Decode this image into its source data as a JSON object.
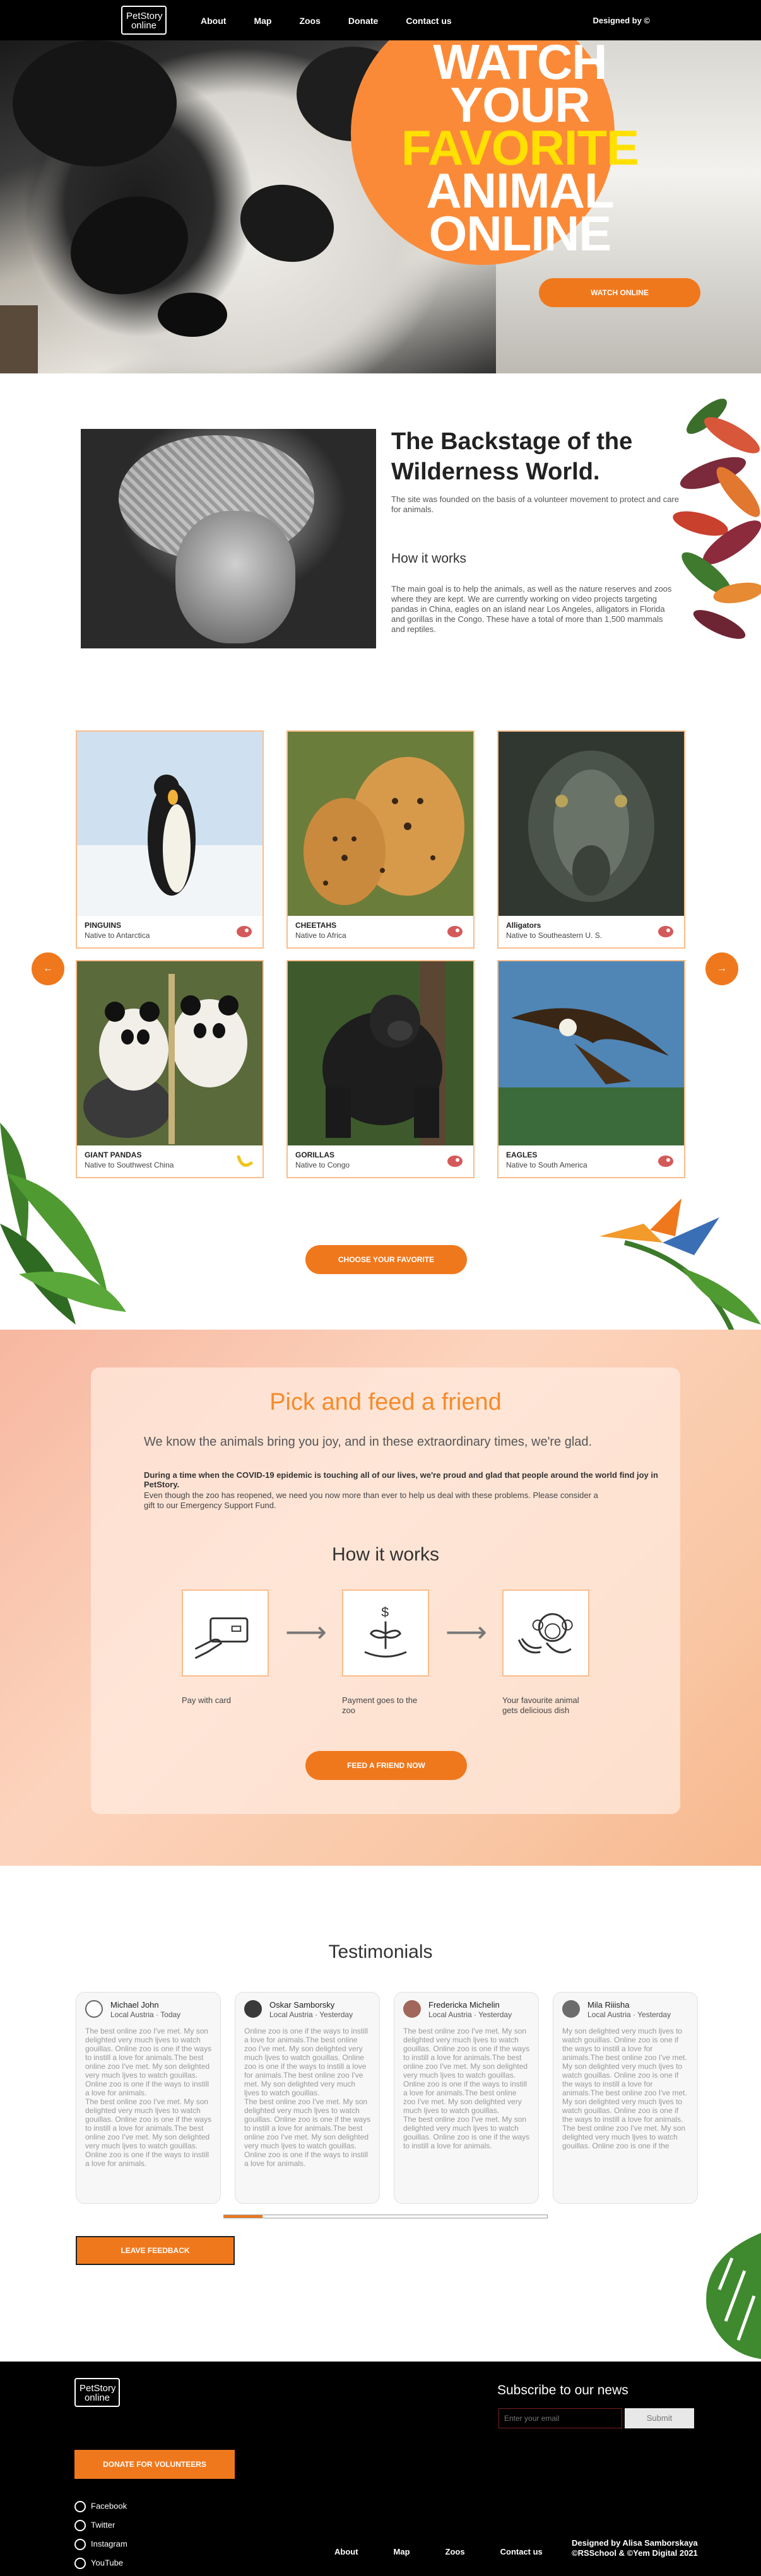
{
  "header": {
    "logo_line1": "PetStory",
    "logo_line2": "online",
    "nav": [
      "About",
      "Map",
      "Zoos",
      "Donate",
      "Contact us"
    ],
    "designed_by": "Designed by ©"
  },
  "hero": {
    "line1": "WATCH",
    "line2": "YOUR",
    "line3": "FAVORITE",
    "line4": "ANIMAL",
    "line5": "ONLINE",
    "button": "WATCH ONLINE"
  },
  "backstage": {
    "title": "The Backstage of the Wilderness World.",
    "text1": "The site was founded on the basis of a volunteer movement to protect and care for animals.",
    "subtitle": "How it works",
    "text2": "The main goal is to help the animals, as well as the nature reserves and zoos where they are kept. We are currently working on video projects targeting pandas in China, eagles on an island near Los Angeles, alligators in Florida and gorillas in the Congo. These have a total of more than 1,500 mammals and reptiles."
  },
  "animals": [
    {
      "name": "PINGUINS",
      "native": "Native to Antarctica",
      "badge": "meat-icon"
    },
    {
      "name": "CHEETAHS",
      "native": "Native to Africa",
      "badge": "meat-icon"
    },
    {
      "name": "Alligators",
      "native": "Native to Southeastern U. S.",
      "badge": "meat-icon"
    },
    {
      "name": "GIANT PANDAS",
      "native": "Native to Southwest China",
      "badge": "banana-icon"
    },
    {
      "name": "GORILLAS",
      "native": "Native to Congo",
      "badge": "meat-icon"
    },
    {
      "name": "EAGLES",
      "native": "Native to South America",
      "badge": "meat-icon"
    }
  ],
  "carousel": {
    "prev": "←",
    "next": "→"
  },
  "favorite_button": "CHOOSE YOUR FAVORITE",
  "feed": {
    "title": "Pick and feed a friend",
    "lead": "We know the animals bring you joy, and in these extraordinary times, we're glad.",
    "p1": "During a time when the COVID-19 epidemic is touching all of our lives, we're proud and glad that people around the world find joy in PetStory.",
    "p2": "Even though the zoo has reopened, we need you now more than ever to help us deal with these problems. Please consider a gift to our Emergency Support Fund.",
    "subtitle": "How it works",
    "steps": [
      {
        "label": "Pay with card",
        "icon": "credit-card-icon"
      },
      {
        "label": "Payment goes to the zoo",
        "icon": "money-plant-icon"
      },
      {
        "label": "Your favourite animal gets delicious dish",
        "icon": "monkey-banana-icon"
      }
    ],
    "button": "FEED A FRIEND NOW"
  },
  "testimonials": {
    "title": "Testimonials",
    "items": [
      {
        "name": "Michael John",
        "meta": "Local Austria · Today",
        "text": "The best online zoo I've met. My son delighted very much ljves to watch gouillas. Online zoo is one if the ways to instill a love for animals.The best online zoo I've met. My son delighted very much ljves to watch gouillas. Online zoo is one if the ways to instill a love for animals.\nThe best online zoo I've met. My son delighted very much ljves to watch gouillas. Online zoo is one if the ways to instill a love for animals.The best online zoo I've met. My son delighted very much ljves to watch gouillas. Online zoo is one if the ways to instill a love for animals."
      },
      {
        "name": "Oskar Samborsky",
        "meta": "Local Austria · Yesterday",
        "text": "Online zoo is one if the ways to instill a love for animals.The best online zoo I've met. My son delighted very much ljves to watch gouillas. Online zoo is one if the ways to instill a love for animals.The best online zoo I've met. My son delighted very much ljves to watch gouillas.\nThe best online zoo I've met. My son delighted very much ljves to watch gouillas. Online zoo is one if the ways to instill a love for animals.The best online zoo I've met. My son delighted very much ljves to watch gouillas. Online zoo is one if the ways to instill a love for animals."
      },
      {
        "name": "Fredericka Michelin",
        "meta": "Local Austria · Yesterday",
        "text": "The best online zoo I've met. My son delighted very much ljves to watch gouillas. Online zoo is one if the ways to instill a love for animals.The best online zoo I've met. My son delighted very much ljves to watch gouillas. Online zoo is one if the ways to instill a love for animals.The best online zoo I've met. My son delighted very much ljves to watch gouillas.\nThe best online zoo I've met. My son delighted very much ljves to watch gouillas. Online zoo is one if the ways to instill a love for animals."
      },
      {
        "name": "Mila Riiisha",
        "meta": "Local Austria · Yesterday",
        "text": "My son delighted very much ljves to watch gouillas. Online zoo is one if the ways to instill a love for animals.The best online zoo I've met. My son delighted very much ljves to watch gouillas. Online zoo is one if the ways to instill a love for animals.The best online zoo I've met. My son delighted very much ljves to watch gouillas. Online zoo is one if the ways to instill a love for animals.\nThe best online zoo I've met. My son delighted very much ljves to watch gouillas. Online zoo is one if the"
      }
    ],
    "scroll_progress": 0.12,
    "feedback_button": "LEAVE FEEDBACK"
  },
  "footer": {
    "logo_line1": "PetStory",
    "logo_line2": "online",
    "subscribe_title": "Subscribe to our news",
    "email_placeholder": "Enter your email",
    "submit": "Submit",
    "donate": "DONATE FOR VOLUNTEERS",
    "social": [
      {
        "label": "Facebook",
        "icon": "facebook-icon"
      },
      {
        "label": "Twitter",
        "icon": "twitter-icon"
      },
      {
        "label": "Instagram",
        "icon": "instagram-icon"
      },
      {
        "label": "YouTube",
        "icon": "youtube-icon"
      }
    ],
    "nav": [
      "About",
      "Map",
      "Zoos",
      "Contact us"
    ],
    "credit1": "Designed by Alisa Samborskaya",
    "credit2": "©RSSchool & ©Yem Digital 2021"
  },
  "colors": {
    "accent": "#f0781c",
    "card_border": "#fbbd8b",
    "title_orange": "#f68b2b",
    "hero_yellow": "#ffe000"
  }
}
